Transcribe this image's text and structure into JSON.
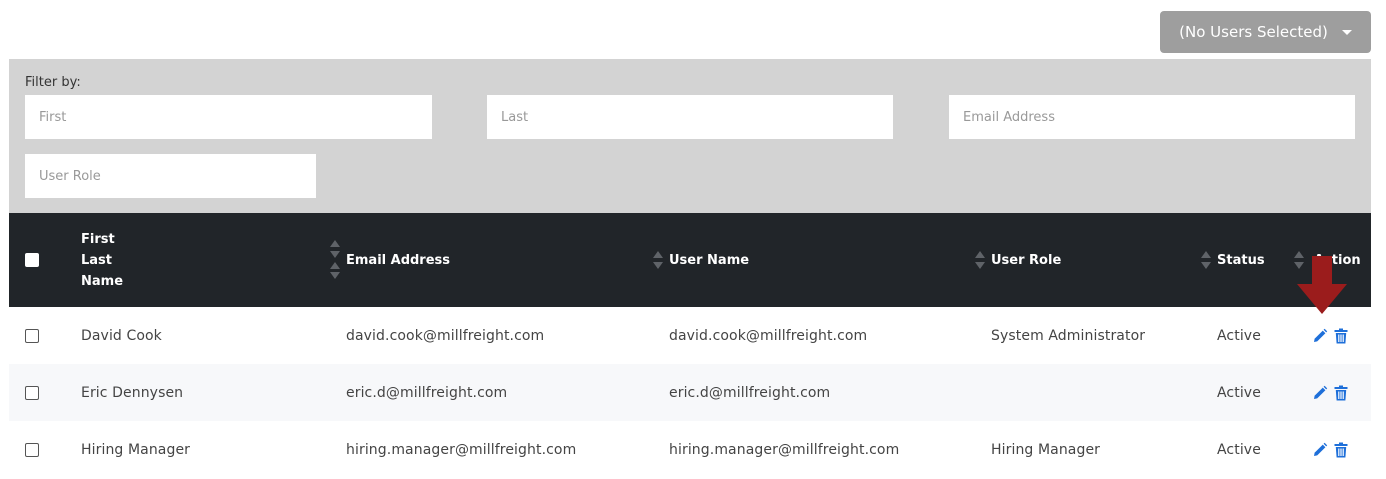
{
  "toolbar": {
    "bulk_action_label": "(No Users Selected)"
  },
  "filters": {
    "label": "Filter by:",
    "first_placeholder": "First",
    "last_placeholder": "Last",
    "email_placeholder": "Email Address",
    "role_placeholder": "User Role"
  },
  "table": {
    "headers": {
      "name_line1": "First",
      "name_line2": "Last",
      "name_line3": "Name",
      "email": "Email Address",
      "username": "User Name",
      "role": "User Role",
      "status": "Status",
      "action": "Action"
    },
    "rows": [
      {
        "name": "David Cook",
        "email": "david.cook@millfreight.com",
        "username": "david.cook@millfreight.com",
        "role": "System Administrator",
        "status": "Active"
      },
      {
        "name": "Eric Dennysen",
        "email": "eric.d@millfreight.com",
        "username": "eric.d@millfreight.com",
        "role": "",
        "status": "Active"
      },
      {
        "name": "Hiring Manager",
        "email": "hiring.manager@millfreight.com",
        "username": "hiring.manager@millfreight.com",
        "role": "Hiring Manager",
        "status": "Active"
      }
    ]
  },
  "colors": {
    "header_bg": "#212529",
    "filter_bg": "#d3d3d3",
    "action_icon": "#1e6fd9",
    "annotation_arrow": "#9b1c1c",
    "dropdown_bg": "#9e9e9e"
  },
  "icons": {
    "edit": "pencil-icon",
    "delete": "trash-icon",
    "sort": "sort-icon",
    "dropdown": "caret-down-icon"
  }
}
